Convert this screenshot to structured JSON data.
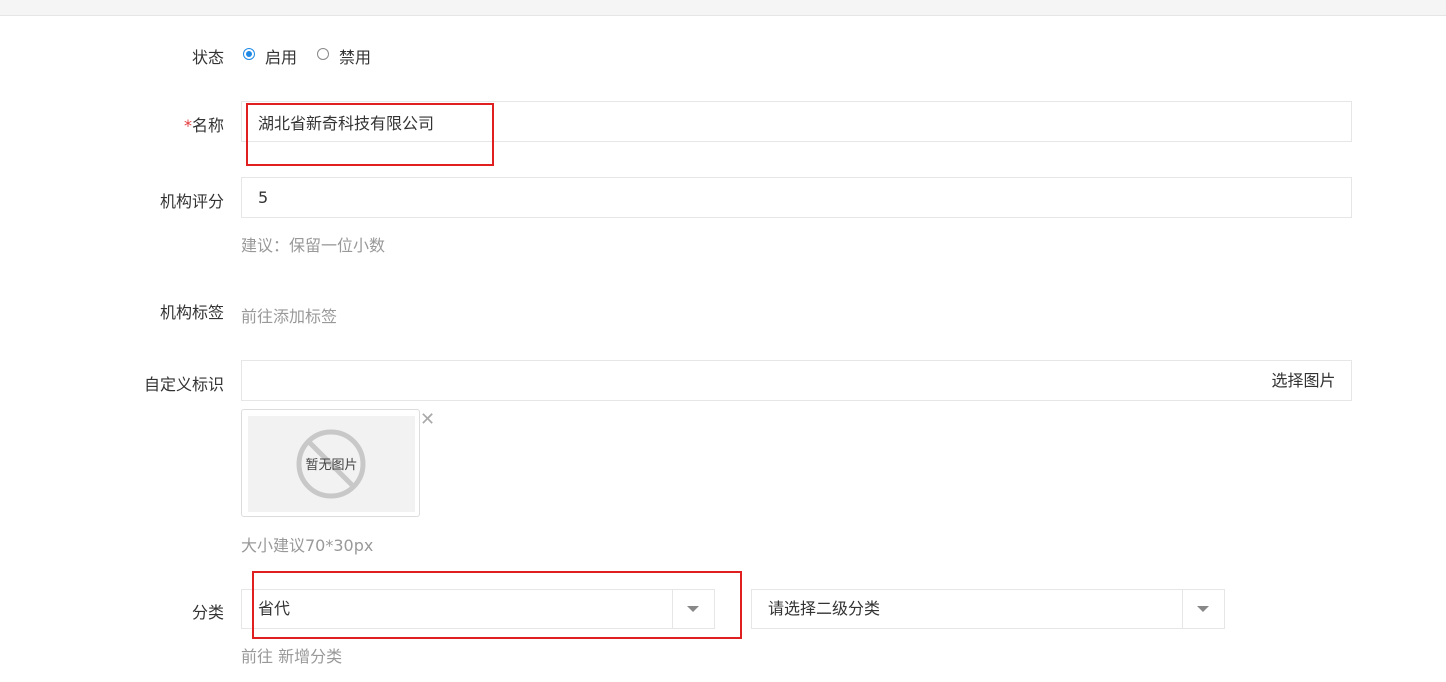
{
  "status": {
    "label": "状态",
    "options": [
      {
        "label": "启用",
        "checked": true
      },
      {
        "label": "禁用",
        "checked": false
      }
    ]
  },
  "name": {
    "required_mark": "*",
    "label": "名称",
    "value": "湖北省新奇科技有限公司"
  },
  "rating": {
    "label": "机构评分",
    "value": "5",
    "help": "建议：保留一位小数"
  },
  "tags": {
    "label": "机构标签",
    "link": "前往添加标签"
  },
  "custom_logo": {
    "label": "自定义标识",
    "value": "",
    "button": "选择图片",
    "placeholder_image_text": "暂无图片",
    "remove_glyph": "✕",
    "help": "大小建议70*30px"
  },
  "category": {
    "label": "分类",
    "primary_value": "省代",
    "secondary_placeholder": "请选择二级分类",
    "link": "前往 新增分类"
  },
  "colors": {
    "accent": "#1e88e5",
    "highlight": "#e02020",
    "required": "#e4393c"
  }
}
